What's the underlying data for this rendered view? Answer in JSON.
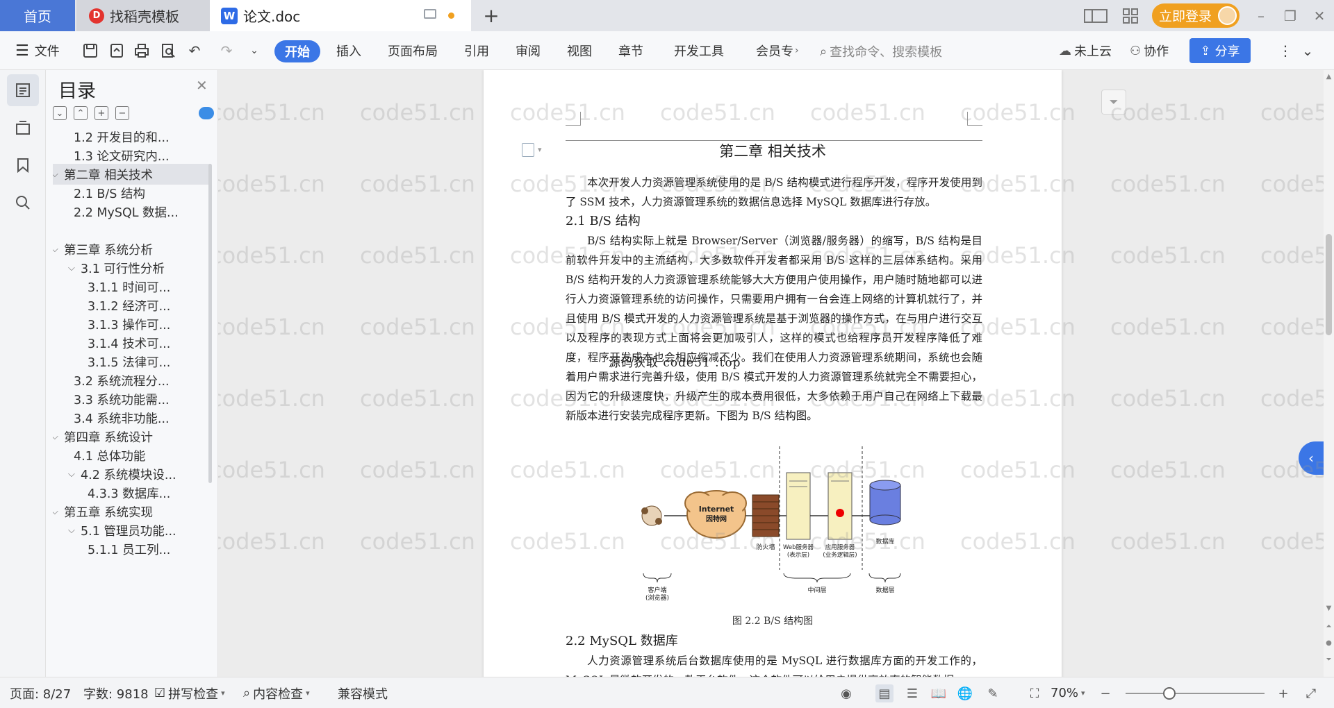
{
  "tabs": {
    "home": "首页",
    "docer": "找稻壳模板",
    "doc": "论文.doc",
    "new_tab": "+",
    "login": "立即登录"
  },
  "ribbon": {
    "file": "文件",
    "menus": [
      "开始",
      "插入",
      "页面布局",
      "引用",
      "审阅",
      "视图",
      "章节",
      "开发工具",
      "会员专"
    ],
    "search_placeholder": "查找命令、搜索模板",
    "cloud": "未上云",
    "collab": "协作",
    "share": "分享"
  },
  "toc": {
    "title": "目录",
    "items": [
      {
        "label": "1.2 开发目的和...",
        "level": 2
      },
      {
        "label": "1.3 论文研究内...",
        "level": 2
      },
      {
        "label": "第二章 相关技术",
        "level": 1,
        "active": true
      },
      {
        "label": "2.1 B/S 结构",
        "level": 2
      },
      {
        "label": "2.2 MySQL 数据...",
        "level": 2
      },
      {
        "label": "第三章 系统分析",
        "level": 1
      },
      {
        "label": "3.1 可行性分析",
        "level": 2
      },
      {
        "label": "3.1.1 时间可...",
        "level": 3
      },
      {
        "label": "3.1.2 经济可...",
        "level": 3
      },
      {
        "label": "3.1.3 操作可...",
        "level": 3
      },
      {
        "label": "3.1.4 技术可...",
        "level": 3
      },
      {
        "label": "3.1.5 法律可...",
        "level": 3
      },
      {
        "label": "3.2 系统流程分...",
        "level": 2
      },
      {
        "label": "3.3 系统功能需...",
        "level": 2
      },
      {
        "label": "3.4 系统非功能...",
        "level": 2
      },
      {
        "label": "第四章 系统设计",
        "level": 1
      },
      {
        "label": "4.1 总体功能",
        "level": 2
      },
      {
        "label": "4.2 系统模块设...",
        "level": 2
      },
      {
        "label": "4.3.3 数据库...",
        "level": 3
      },
      {
        "label": "第五章 系统实现",
        "level": 1
      },
      {
        "label": "5.1 管理员功能...",
        "level": 2
      },
      {
        "label": "5.1.1 员工列...",
        "level": 3
      }
    ]
  },
  "document": {
    "chapter_title": "第二章  相关技术",
    "intro": "本次开发人力资源管理系统使用的是 B/S 结构模式进行程序开发，程序开发使用到了 SSM 技术，人力资源管理系统的数据信息选择 MySQL 数据库进行存放。",
    "sec21_title": "2.1 B/S 结构",
    "sec21_body": "B/S 结构实际上就是 Browser/Server（浏览器/服务器）的缩写，B/S 结构是目前软件开发中的主流结构，大多数软件开发者都采用 B/S 这样的三层体系结构。采用 B/S 结构开发的人力资源管理系统能够大大方便用户使用操作，用户随时随地都可以进行人力资源管理系统的访问操作，只需要用户拥有一台会连上网络的计算机就行了，并且使用 B/S 模式开发的人力资源管理系统是基于浏览器的操作方式，在与用户进行交互以及程序的表现方式上面将会更加吸引人，这样的模式也给程序员开发程序降低了难度，程序开发成本也会相应缩减不少。我们在使用人力资源管理系统期间，系统也会随着用户需求进行完善升级，使用 B/S 模式开发的人力资源管理系统就完全不需要担心，因为它的升级速度快，升级产生的成本费用很低，大多依赖于用户自己在网络上下载最新版本进行安装完成程序更新。下图为 B/S 结构图。",
    "stamp_text": "源码获取 code51 .top",
    "diagram": {
      "internet": "Internet",
      "internet_cn": "因特网",
      "firewall": "防火墙",
      "web_server": "Web服务器\n(表示层)",
      "app_server": "应用服务器\n(业务逻辑层)",
      "database": "数据库",
      "client_layer": "客户端\n(浏览器)",
      "middle_layer": "中间层",
      "data_layer": "数据层"
    },
    "fig_caption": "图 2.2 B/S 结构图",
    "sec22_title": "2.2 MySQL 数据库",
    "sec22_body": "人力资源管理系统后台数据库使用的是 MySQL 进行数据库方面的开发工作的，MySQL 是微软开发的一款平台软件，这个软件可以给用户提供高效率的智能数据"
  },
  "watermark": "code51.cn",
  "statusbar": {
    "page": "页面: 8/27",
    "words": "字数: 9818",
    "spellcheck": "拼写检查",
    "content_check": "内容检查",
    "compat": "兼容模式",
    "zoom": "70%",
    "zoom_level": 0.7
  },
  "colors": {
    "accent": "#3b76e6",
    "login": "#f0a020",
    "home_tab": "#4a77d6"
  }
}
